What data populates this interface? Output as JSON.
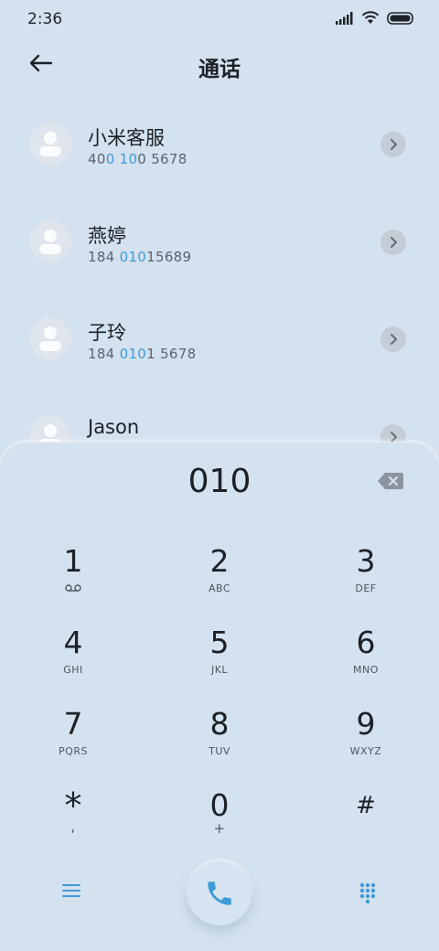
{
  "status": {
    "time": "2:36"
  },
  "header": {
    "title": "通话"
  },
  "contacts": [
    {
      "name": "小米客服",
      "number_parts": [
        "40",
        "0 10",
        "0 5678"
      ]
    },
    {
      "name": "燕婷",
      "number_parts": [
        "184 ",
        "010",
        "15689"
      ]
    },
    {
      "name": "子玲",
      "number_parts": [
        "184 ",
        "010",
        "1 5678"
      ]
    },
    {
      "name": "Jason",
      "number_parts": [
        "",
        "",
        ""
      ]
    }
  ],
  "dialpad": {
    "entered": "010",
    "keys": [
      {
        "digit": "1",
        "letters": ""
      },
      {
        "digit": "2",
        "letters": "ABC"
      },
      {
        "digit": "3",
        "letters": "DEF"
      },
      {
        "digit": "4",
        "letters": "GHI"
      },
      {
        "digit": "5",
        "letters": "JKL"
      },
      {
        "digit": "6",
        "letters": "MNO"
      },
      {
        "digit": "7",
        "letters": "PQRS"
      },
      {
        "digit": "8",
        "letters": "TUV"
      },
      {
        "digit": "9",
        "letters": "WXYZ"
      },
      {
        "digit": "*",
        "letters": ","
      },
      {
        "digit": "0",
        "letters": "+"
      },
      {
        "digit": "#",
        "letters": ""
      }
    ]
  },
  "icons": {
    "back": "arrow-left-icon",
    "chevron": "chevron-right-icon",
    "backspace": "backspace-icon",
    "voicemail": "voicemail-icon",
    "menu": "menu-icon",
    "call": "phone-icon",
    "keypad": "dialpad-icon"
  },
  "colors": {
    "background": "#d4e1ee",
    "accent": "#3d9bd6",
    "highlight": "#3d9bd6"
  }
}
